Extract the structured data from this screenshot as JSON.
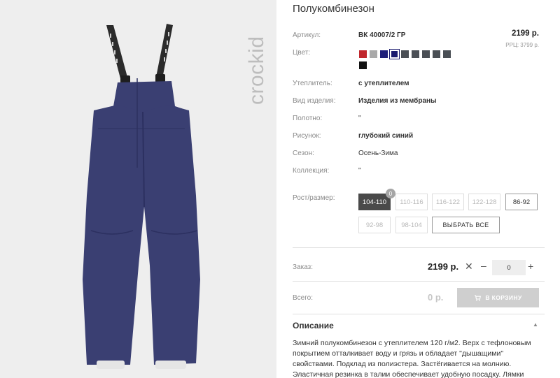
{
  "product": {
    "title": "Полукомбинезон",
    "brand_logo": "crockid",
    "price": "2199 р.",
    "rrp": "РРЦ: 3799 р."
  },
  "attributes": [
    {
      "label": "Артикул:",
      "value": "ВК 40007/2 ГР",
      "bold": true
    },
    {
      "label": "Цвет:",
      "value": ""
    },
    {
      "label": "Утеплитель:",
      "value": "с утеплителем",
      "bold": true
    },
    {
      "label": "Вид изделия:",
      "value": "Изделия из мембраны",
      "bold": true
    },
    {
      "label": "Полотно:",
      "value": "\"",
      "bold": false
    },
    {
      "label": "Рисунок:",
      "value": "глубокий синий",
      "bold": true
    },
    {
      "label": "Сезон:",
      "value": "Осень-Зима",
      "bold": false
    },
    {
      "label": "Коллекция:",
      "value": "\"",
      "bold": false
    },
    {
      "label": "Рост/размер:",
      "value": ""
    }
  ],
  "colors": [
    {
      "hex": "#c0272d",
      "selected": false
    },
    {
      "hex": "#a9a9a9",
      "selected": false
    },
    {
      "hex": "#1f1f7a",
      "selected": false
    },
    {
      "hex": "#1a1a6e",
      "selected": true
    },
    {
      "hex": "#4a4f55",
      "selected": false
    },
    {
      "hex": "#4a4f55",
      "selected": false
    },
    {
      "hex": "#4a4f55",
      "selected": false
    },
    {
      "hex": "#4a4f55",
      "selected": false
    },
    {
      "hex": "#4a4f55",
      "selected": false
    },
    {
      "hex": "#111111",
      "selected": false
    }
  ],
  "sizes": [
    {
      "label": "104-110",
      "state": "active",
      "badge": "0"
    },
    {
      "label": "110-116",
      "state": "disabled"
    },
    {
      "label": "116-122",
      "state": "disabled"
    },
    {
      "label": "122-128",
      "state": "disabled"
    },
    {
      "label": "86-92",
      "state": "available"
    },
    {
      "label": "92-98",
      "state": "disabled"
    },
    {
      "label": "98-104",
      "state": "disabled"
    }
  ],
  "select_all_label": "ВЫБРАТЬ ВСЕ",
  "order": {
    "label": "Заказ:",
    "price": "2199 р.",
    "times": "✕",
    "minus": "–",
    "quantity": "0",
    "plus": "+"
  },
  "total": {
    "label": "Всего:",
    "value": "0 р.",
    "cart_button": "В КОРЗИНУ",
    "cart_icon": "cart-icon"
  },
  "description": {
    "heading": "Описание",
    "toggle_icon": "chevron-up-icon",
    "text": "Зимний полукомбинезон с утеплителем 120 г/м2. Верх с тефлоновым покрытием отталкивает воду и грязь и обладает \"дышащими\" свойствами. Подклад из полиэстера. Застёгивается на молнию. Эластичная резинка в талии обеспечивает удобную посадку. Лямки"
  },
  "colors_theme": {
    "panel_bg": "#eeeeee",
    "garment": "#3a3f72",
    "active_size": "#4a4a4a",
    "cart_disabled": "#cfcfcf"
  }
}
